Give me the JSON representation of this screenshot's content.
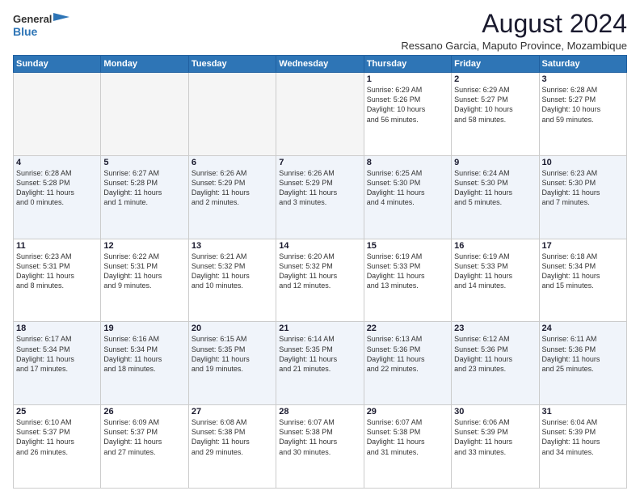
{
  "header": {
    "logo_general": "General",
    "logo_blue": "Blue",
    "month_title": "August 2024",
    "subtitle": "Ressano Garcia, Maputo Province, Mozambique"
  },
  "days_of_week": [
    "Sunday",
    "Monday",
    "Tuesday",
    "Wednesday",
    "Thursday",
    "Friday",
    "Saturday"
  ],
  "weeks": [
    [
      {
        "day": "",
        "lines": []
      },
      {
        "day": "",
        "lines": []
      },
      {
        "day": "",
        "lines": []
      },
      {
        "day": "",
        "lines": []
      },
      {
        "day": "1",
        "lines": [
          "Sunrise: 6:29 AM",
          "Sunset: 5:26 PM",
          "Daylight: 10 hours",
          "and 56 minutes."
        ]
      },
      {
        "day": "2",
        "lines": [
          "Sunrise: 6:29 AM",
          "Sunset: 5:27 PM",
          "Daylight: 10 hours",
          "and 58 minutes."
        ]
      },
      {
        "day": "3",
        "lines": [
          "Sunrise: 6:28 AM",
          "Sunset: 5:27 PM",
          "Daylight: 10 hours",
          "and 59 minutes."
        ]
      }
    ],
    [
      {
        "day": "4",
        "lines": [
          "Sunrise: 6:28 AM",
          "Sunset: 5:28 PM",
          "Daylight: 11 hours",
          "and 0 minutes."
        ]
      },
      {
        "day": "5",
        "lines": [
          "Sunrise: 6:27 AM",
          "Sunset: 5:28 PM",
          "Daylight: 11 hours",
          "and 1 minute."
        ]
      },
      {
        "day": "6",
        "lines": [
          "Sunrise: 6:26 AM",
          "Sunset: 5:29 PM",
          "Daylight: 11 hours",
          "and 2 minutes."
        ]
      },
      {
        "day": "7",
        "lines": [
          "Sunrise: 6:26 AM",
          "Sunset: 5:29 PM",
          "Daylight: 11 hours",
          "and 3 minutes."
        ]
      },
      {
        "day": "8",
        "lines": [
          "Sunrise: 6:25 AM",
          "Sunset: 5:30 PM",
          "Daylight: 11 hours",
          "and 4 minutes."
        ]
      },
      {
        "day": "9",
        "lines": [
          "Sunrise: 6:24 AM",
          "Sunset: 5:30 PM",
          "Daylight: 11 hours",
          "and 5 minutes."
        ]
      },
      {
        "day": "10",
        "lines": [
          "Sunrise: 6:23 AM",
          "Sunset: 5:30 PM",
          "Daylight: 11 hours",
          "and 7 minutes."
        ]
      }
    ],
    [
      {
        "day": "11",
        "lines": [
          "Sunrise: 6:23 AM",
          "Sunset: 5:31 PM",
          "Daylight: 11 hours",
          "and 8 minutes."
        ]
      },
      {
        "day": "12",
        "lines": [
          "Sunrise: 6:22 AM",
          "Sunset: 5:31 PM",
          "Daylight: 11 hours",
          "and 9 minutes."
        ]
      },
      {
        "day": "13",
        "lines": [
          "Sunrise: 6:21 AM",
          "Sunset: 5:32 PM",
          "Daylight: 11 hours",
          "and 10 minutes."
        ]
      },
      {
        "day": "14",
        "lines": [
          "Sunrise: 6:20 AM",
          "Sunset: 5:32 PM",
          "Daylight: 11 hours",
          "and 12 minutes."
        ]
      },
      {
        "day": "15",
        "lines": [
          "Sunrise: 6:19 AM",
          "Sunset: 5:33 PM",
          "Daylight: 11 hours",
          "and 13 minutes."
        ]
      },
      {
        "day": "16",
        "lines": [
          "Sunrise: 6:19 AM",
          "Sunset: 5:33 PM",
          "Daylight: 11 hours",
          "and 14 minutes."
        ]
      },
      {
        "day": "17",
        "lines": [
          "Sunrise: 6:18 AM",
          "Sunset: 5:34 PM",
          "Daylight: 11 hours",
          "and 15 minutes."
        ]
      }
    ],
    [
      {
        "day": "18",
        "lines": [
          "Sunrise: 6:17 AM",
          "Sunset: 5:34 PM",
          "Daylight: 11 hours",
          "and 17 minutes."
        ]
      },
      {
        "day": "19",
        "lines": [
          "Sunrise: 6:16 AM",
          "Sunset: 5:34 PM",
          "Daylight: 11 hours",
          "and 18 minutes."
        ]
      },
      {
        "day": "20",
        "lines": [
          "Sunrise: 6:15 AM",
          "Sunset: 5:35 PM",
          "Daylight: 11 hours",
          "and 19 minutes."
        ]
      },
      {
        "day": "21",
        "lines": [
          "Sunrise: 6:14 AM",
          "Sunset: 5:35 PM",
          "Daylight: 11 hours",
          "and 21 minutes."
        ]
      },
      {
        "day": "22",
        "lines": [
          "Sunrise: 6:13 AM",
          "Sunset: 5:36 PM",
          "Daylight: 11 hours",
          "and 22 minutes."
        ]
      },
      {
        "day": "23",
        "lines": [
          "Sunrise: 6:12 AM",
          "Sunset: 5:36 PM",
          "Daylight: 11 hours",
          "and 23 minutes."
        ]
      },
      {
        "day": "24",
        "lines": [
          "Sunrise: 6:11 AM",
          "Sunset: 5:36 PM",
          "Daylight: 11 hours",
          "and 25 minutes."
        ]
      }
    ],
    [
      {
        "day": "25",
        "lines": [
          "Sunrise: 6:10 AM",
          "Sunset: 5:37 PM",
          "Daylight: 11 hours",
          "and 26 minutes."
        ]
      },
      {
        "day": "26",
        "lines": [
          "Sunrise: 6:09 AM",
          "Sunset: 5:37 PM",
          "Daylight: 11 hours",
          "and 27 minutes."
        ]
      },
      {
        "day": "27",
        "lines": [
          "Sunrise: 6:08 AM",
          "Sunset: 5:38 PM",
          "Daylight: 11 hours",
          "and 29 minutes."
        ]
      },
      {
        "day": "28",
        "lines": [
          "Sunrise: 6:07 AM",
          "Sunset: 5:38 PM",
          "Daylight: 11 hours",
          "and 30 minutes."
        ]
      },
      {
        "day": "29",
        "lines": [
          "Sunrise: 6:07 AM",
          "Sunset: 5:38 PM",
          "Daylight: 11 hours",
          "and 31 minutes."
        ]
      },
      {
        "day": "30",
        "lines": [
          "Sunrise: 6:06 AM",
          "Sunset: 5:39 PM",
          "Daylight: 11 hours",
          "and 33 minutes."
        ]
      },
      {
        "day": "31",
        "lines": [
          "Sunrise: 6:04 AM",
          "Sunset: 5:39 PM",
          "Daylight: 11 hours",
          "and 34 minutes."
        ]
      }
    ]
  ]
}
